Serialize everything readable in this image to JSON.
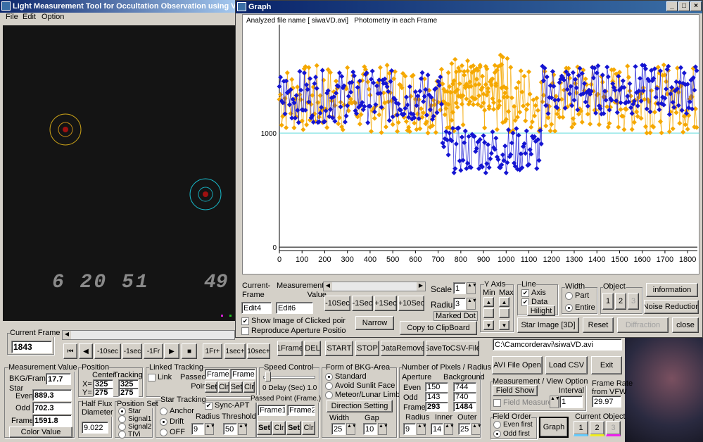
{
  "main": {
    "title": "Light Measurement Tool for Occultation Observation using Video",
    "menu": [
      "File",
      "Edit",
      "Option"
    ],
    "osd": {
      "time": "6 20 51",
      "frame_digits": "49"
    }
  },
  "graph": {
    "title": "Graph",
    "heading": "Analyzed file name [ siwaVD.avi]   Photometry in each Frame",
    "yticks": [
      "1000",
      "0"
    ],
    "xticks": [
      "0",
      "100",
      "200",
      "300",
      "400",
      "500",
      "600",
      "700",
      "800",
      "900",
      "1000",
      "1100",
      "1200",
      "1300",
      "1400",
      "1500",
      "1600",
      "1700",
      "1800"
    ],
    "controls": {
      "current_frame_label": "Current-\nFrame",
      "measurement_value_label": "Measurement-\nValue",
      "edit4": "Edit4",
      "edit6": "Edit6",
      "btn_m10": "-10Sec",
      "btn_m1": "-1Sec",
      "btn_p1": "+1Sec",
      "btn_p10": "+10Sec",
      "show_image": "Show Image of Clicked poir",
      "reproduce": "Reproduce Aperture Positio",
      "narrow": "Narrow",
      "scale_label": "Scale",
      "scale_val": "1",
      "radius_label": "Radius",
      "radius_val": "3",
      "marked_dot": "Marked Dot",
      "copy": "Copy to ClipBoard",
      "yaxis": "Y Axis",
      "min": "Min",
      "max": "Max",
      "line": "Line",
      "axis": "Axis",
      "data": "Data",
      "hilight": "Hilight",
      "width": "Width",
      "part": "Part",
      "entire": "Entire",
      "object": "Object",
      "obj": [
        "1",
        "2",
        "3"
      ],
      "information": "information",
      "noise": "Noise Reduction",
      "star_image": "Star Image [3D]",
      "reset": "Reset",
      "diffraction": "Diffraction",
      "close": "close"
    }
  },
  "bottom": {
    "current_frame_label": "Current Frame",
    "current_frame": "1843",
    "transport": [
      "⏮",
      "◀",
      "-10sec",
      "-1sec",
      "-1Fr",
      "▶",
      "■",
      "1Fr+",
      "1sec+",
      "10sec+"
    ],
    "actions": [
      "1Frame",
      "DEL",
      "START",
      "STOP",
      "DataRemove",
      "SaveToCSV-File"
    ],
    "file_path": "C:\\Camcorderavi\\siwaVD.avi",
    "avi_open": "AVI File Open",
    "load_csv": "Load CSV",
    "exit": "Exit",
    "mv": {
      "title": "Measurement Value",
      "bkg_label": "BKG/Frame",
      "bkg": "17.7",
      "star": "Star",
      "even_label": "Even",
      "even": "889.3",
      "odd_label": "Odd",
      "odd": "702.3",
      "frame_label": "Frame",
      "frame": "1591.8",
      "color_btn": "Color Value"
    },
    "pos": {
      "title": "Position",
      "center": "Center",
      "tracking": "Tracking",
      "x": "X=",
      "y": "Y=",
      "cx": "325",
      "cy": "275",
      "tx": "325",
      "ty": "275"
    },
    "hfd": {
      "label": "Half Flux\nDiameter",
      "val": "9.022"
    },
    "posset": {
      "title": "Position Set",
      "opts": [
        "Star",
        "Signal1",
        "Signal2",
        "TIVi"
      ]
    },
    "linked": {
      "title": "Linked Tracking",
      "link": "Link",
      "passed": "Passed-\nPoint",
      "f1": "Frame1",
      "f2": "Frame2",
      "set": "Set",
      "clr": "Clr"
    },
    "startrack": {
      "title": "Star Tracking",
      "anchor": "Anchor",
      "drift": "Drift",
      "off": "OFF",
      "sync": "Sync-APT",
      "radius": "Radius",
      "threshold": "Threshold",
      "rval": "9",
      "tval": "50"
    },
    "speed": {
      "title": "Speed Control",
      "delay": "0  Delay (Sec) 1.0"
    },
    "passed": {
      "title": "Passed Point (Frame.)",
      "f1": "Frame1",
      "f2": "Frame2",
      "set": "Set",
      "clr": "Clr"
    },
    "bkg": {
      "title": "Form of BKG-Area",
      "opts": [
        "Standard",
        "Avoid Sunlit Face",
        "Meteor/Lunar Limb"
      ],
      "dir": "Direction Setting",
      "width": "Width",
      "gap": "Gap",
      "wval": "25",
      "gval": "10"
    },
    "pix": {
      "title": "Number of Pixels / Radius",
      "aperture": "Aperture",
      "background": "Background",
      "even": "Even",
      "odd": "Odd",
      "frame": "Frame",
      "ae": "150",
      "be": "744",
      "ao": "143",
      "bo": "740",
      "af": "293",
      "bf": "1484",
      "radius": "Radius",
      "inner": "Inner",
      "outer": "Outer",
      "r": "9",
      "i": "14",
      "o": "25"
    },
    "mvo": {
      "title": "Measurement / View Option",
      "field_show": "Field Show",
      "interval": "Interval",
      "field_measure": "Field Measure",
      "ival": "1"
    },
    "fps": {
      "title": "Frame Rate\nfrom VFW",
      "val": "29.97"
    },
    "order": {
      "title": "Field Order",
      "even": "Even first",
      "odd": "Odd first"
    },
    "graph_btn": "Graph",
    "cur_obj": {
      "title": "Current Object",
      "opts": [
        "1",
        "2",
        "3"
      ]
    }
  },
  "colors": {
    "series_gold": "#f5a800",
    "series_blue": "#1414d2",
    "titlebar": "#0a246a"
  },
  "chart_data": {
    "type": "line",
    "title": "Analyzed file name [ siwaVD.avi]   Photometry in each Frame",
    "xlabel": "",
    "ylabel": "",
    "xlim": [
      0,
      1843
    ],
    "ylim": [
      -30,
      1950
    ],
    "grid": false,
    "legend": "none",
    "yticks": [
      0,
      1000
    ],
    "xticks": [
      0,
      100,
      200,
      300,
      400,
      500,
      600,
      700,
      800,
      900,
      1000,
      1100,
      1200,
      1300,
      1400,
      1500,
      1600,
      1700,
      1800
    ],
    "series": [
      {
        "color": "#f5a800",
        "segments": [
          {
            "from": 0,
            "to": 1843,
            "base": 1300,
            "spread": 300
          },
          {
            "from": 720,
            "to": 1010,
            "base": 1450,
            "spread": 250
          }
        ]
      },
      {
        "color": "#1414d2",
        "segments": [
          {
            "from": 0,
            "to": 720,
            "base": 1320,
            "spread": 230
          },
          {
            "from": 720,
            "to": 1160,
            "base": 850,
            "spread": 200
          },
          {
            "from": 1160,
            "to": 1843,
            "base": 1380,
            "spread": 220
          }
        ]
      }
    ]
  }
}
